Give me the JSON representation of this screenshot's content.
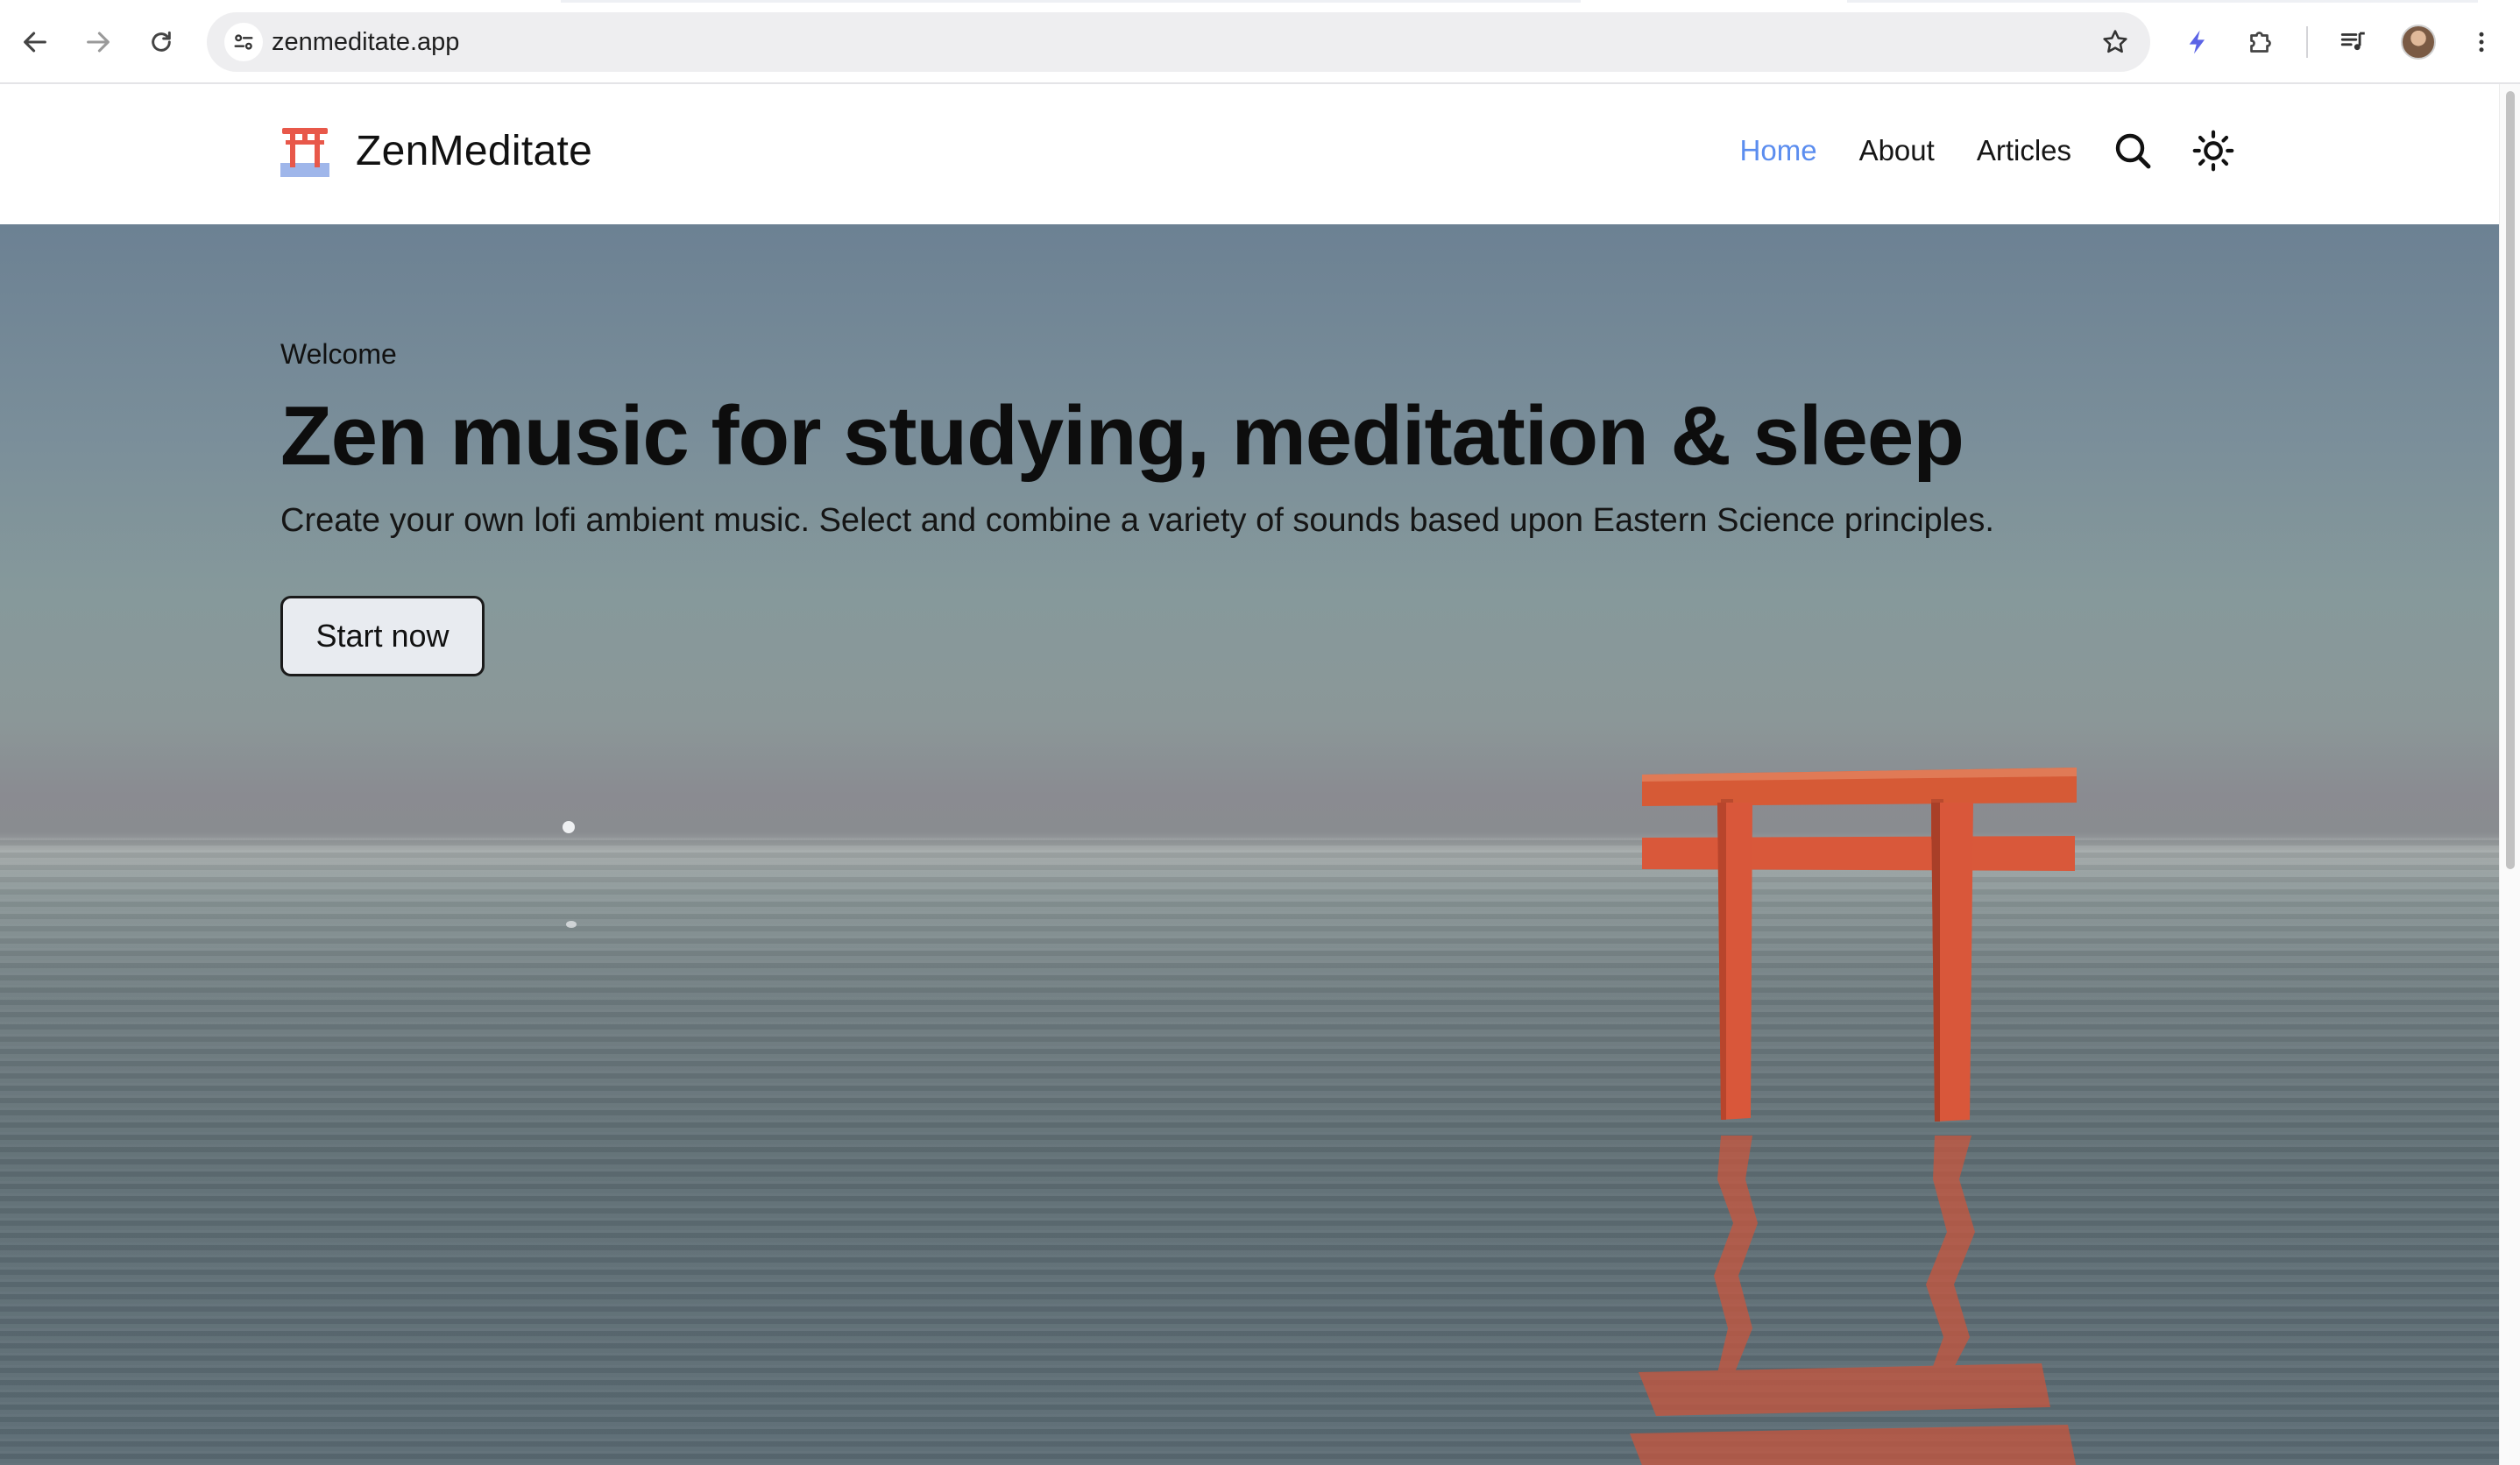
{
  "browser": {
    "url": "zenmeditate.app",
    "icons": [
      "back-icon",
      "forward-icon",
      "reload-icon",
      "site-info-icon",
      "bookmark-star-icon",
      "lightning-extension-icon",
      "extensions-puzzle-icon",
      "media-playlist-icon",
      "profile-avatar",
      "more-vert-icon"
    ]
  },
  "site": {
    "brand_name": "ZenMeditate",
    "logo_icon": "torii-gate-icon",
    "nav": {
      "home": "Home",
      "about": "About",
      "articles": "Articles",
      "active": "Home",
      "active_color": "#5b8def"
    },
    "nav_icons": [
      "search-icon",
      "sun-theme-icon"
    ]
  },
  "hero": {
    "eyebrow": "Welcome",
    "headline": "Zen music for studying, meditation & sleep",
    "subhead": "Create your own lofi ambient music. Select and combine a variety of sounds based upon Eastern Science principles.",
    "cta_label": "Start now",
    "gate_color": "#e05a3a"
  }
}
